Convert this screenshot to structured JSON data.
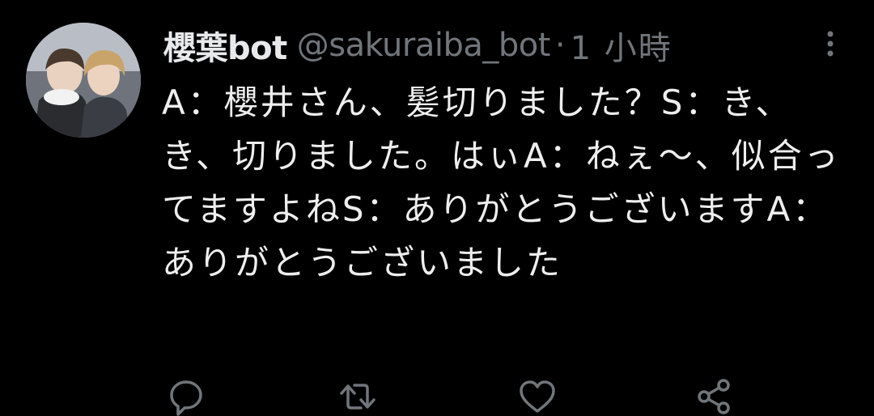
{
  "tweet": {
    "display_name": "櫻葉bot",
    "handle": "@sakuraiba_bot",
    "separator": "·",
    "time": "1 小時",
    "text": "A：櫻井さん、髪切りました？S：き、き、切りました。はぃA：ねぇ～、似合ってますよねS：ありがとうございますA：ありがとうございました"
  },
  "icons": {
    "avatar": "avatar-photo",
    "more": "more-vertical-icon",
    "reply": "reply-icon",
    "retweet": "retweet-icon",
    "like": "heart-icon",
    "share": "share-icon"
  },
  "colors": {
    "background": "#000000",
    "text": "#e7e9ea",
    "secondary": "#71767b"
  }
}
